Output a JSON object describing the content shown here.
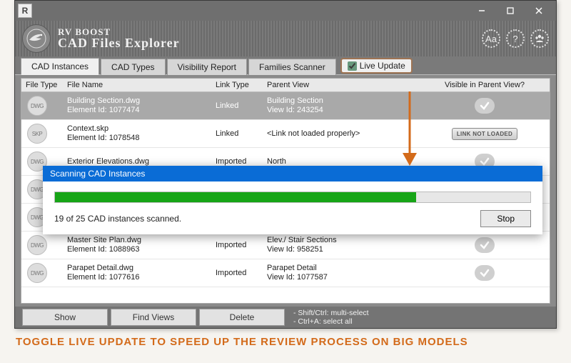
{
  "titlebar": {
    "app_marker": "R"
  },
  "header": {
    "brand_line1": "RV BOOST",
    "brand_line2": "CAD Files Explorer"
  },
  "tabs": [
    {
      "label": "CAD Instances",
      "active": true
    },
    {
      "label": "CAD Types",
      "active": false
    },
    {
      "label": "Visibility Report",
      "active": false
    },
    {
      "label": "Families Scanner",
      "active": false
    }
  ],
  "live_update": {
    "label": "Live Update",
    "checked": true
  },
  "columns": {
    "file_type": "File Type",
    "file_name": "File Name",
    "link_type": "Link Type",
    "parent_view": "Parent View",
    "visible": "Visible in Parent View?"
  },
  "rows": [
    {
      "ftype": "DWG",
      "file_name": "Building Section.dwg",
      "element_id": "Element Id: 1077474",
      "link_type": "Linked",
      "parent_view": "Building Section",
      "view_id": "View Id: 243254",
      "visible": "check",
      "selected": true
    },
    {
      "ftype": "SKP",
      "file_name": "Context.skp",
      "element_id": "Element Id: 1078548",
      "link_type": "Linked",
      "parent_view": "<Link not loaded properly>",
      "view_id": "",
      "visible": "not_loaded",
      "selected": false
    },
    {
      "ftype": "DWG",
      "file_name": "Exterior Elevations.dwg",
      "element_id": "",
      "link_type": "Imported",
      "parent_view": "North",
      "view_id": "",
      "visible": "check",
      "selected": false
    },
    {
      "ftype": "DWG",
      "file_name": "",
      "element_id": "",
      "link_type": "",
      "parent_view": "",
      "view_id": "",
      "visible": "check",
      "selected": false
    },
    {
      "ftype": "DWG",
      "file_name": "",
      "element_id": "",
      "link_type": "",
      "parent_view": "",
      "view_id": "",
      "visible": "check",
      "selected": false
    },
    {
      "ftype": "DWG",
      "file_name": "Master Site Plan.dwg",
      "element_id": "Element Id: 1088963",
      "link_type": "Imported",
      "parent_view": "Elev./ Stair Sections",
      "view_id": "View Id: 958251",
      "visible": "check",
      "selected": false
    },
    {
      "ftype": "DWG",
      "file_name": "Parapet Detail.dwg",
      "element_id": "Element Id: 1077616",
      "link_type": "Imported",
      "parent_view": "Parapet Detail",
      "view_id": "View Id: 1077587",
      "visible": "check",
      "selected": false
    }
  ],
  "bottom_buttons": {
    "show": "Show",
    "find_views": "Find Views",
    "delete": "Delete"
  },
  "status_hints": {
    "line1": "- Shift/Ctrl: multi-select",
    "line2": "- Ctrl+A: select all"
  },
  "scan": {
    "title": "Scanning CAD Instances",
    "scanned": 19,
    "total": 25,
    "status": "19 of 25 CAD instances scanned.",
    "stop": "Stop",
    "progress_pct": 76
  },
  "not_loaded_badge": "LINK NOT LOADED",
  "caption": "TOGGLE LIVE UPDATE TO SPEED UP THE REVIEW PROCESS ON BIG MODELS"
}
